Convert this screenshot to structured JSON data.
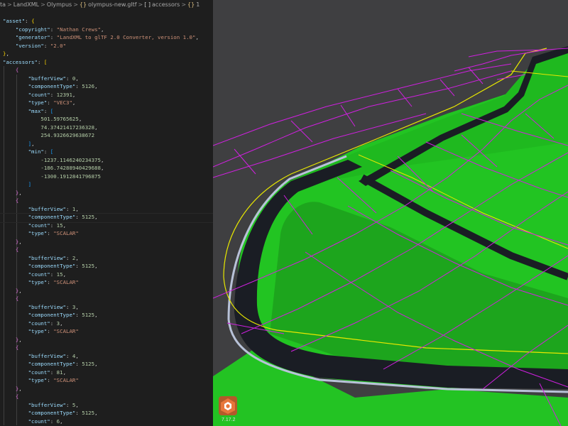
{
  "breadcrumb": {
    "items": [
      {
        "text": "ta",
        "icon": ""
      },
      {
        "text": "LandXML",
        "icon": ""
      },
      {
        "text": "Olympus",
        "icon": ""
      },
      {
        "text": "olympus-new.gltf",
        "icon": "{}"
      },
      {
        "text": "accessors",
        "icon": "[ ]"
      },
      {
        "text": "1",
        "icon": "{}"
      }
    ],
    "separator": ">"
  },
  "code": {
    "lines": [
      [
        [
          "k",
          "\"asset\""
        ],
        [
          "p",
          ": "
        ],
        [
          "b1",
          "{"
        ]
      ],
      [
        [
          "p",
          "    "
        ],
        [
          "k",
          "\"copyright\""
        ],
        [
          "p",
          ": "
        ],
        [
          "s",
          "\"Nathan Crews\""
        ],
        [
          "p",
          ","
        ]
      ],
      [
        [
          "p",
          "    "
        ],
        [
          "k",
          "\"generator\""
        ],
        [
          "p",
          ": "
        ],
        [
          "s",
          "\"LandXML to glTF 2.0 Converter, version 1.0\""
        ],
        [
          "p",
          ","
        ]
      ],
      [
        [
          "p",
          "    "
        ],
        [
          "k",
          "\"version\""
        ],
        [
          "p",
          ": "
        ],
        [
          "s",
          "\"2.0\""
        ]
      ],
      [
        [
          "b1",
          "}"
        ],
        [
          "p",
          ","
        ]
      ],
      [
        [
          "k",
          "\"accessors\""
        ],
        [
          "p",
          ": "
        ],
        [
          "b1",
          "["
        ]
      ],
      [
        [
          "p",
          "    "
        ],
        [
          "b2",
          "{"
        ]
      ],
      [
        [
          "p",
          "        "
        ],
        [
          "k",
          "\"bufferView\""
        ],
        [
          "p",
          ": "
        ],
        [
          "n",
          "0"
        ],
        [
          "p",
          ","
        ]
      ],
      [
        [
          "p",
          "        "
        ],
        [
          "k",
          "\"componentType\""
        ],
        [
          "p",
          ": "
        ],
        [
          "n",
          "5126"
        ],
        [
          "p",
          ","
        ]
      ],
      [
        [
          "p",
          "        "
        ],
        [
          "k",
          "\"count\""
        ],
        [
          "p",
          ": "
        ],
        [
          "n",
          "12391"
        ],
        [
          "p",
          ","
        ]
      ],
      [
        [
          "p",
          "        "
        ],
        [
          "k",
          "\"type\""
        ],
        [
          "p",
          ": "
        ],
        [
          "s",
          "\"VEC3\""
        ],
        [
          "p",
          ","
        ]
      ],
      [
        [
          "p",
          "        "
        ],
        [
          "k",
          "\"max\""
        ],
        [
          "p",
          ": "
        ],
        [
          "b3",
          "["
        ]
      ],
      [
        [
          "p",
          "            "
        ],
        [
          "n",
          "501.59765625"
        ],
        [
          "p",
          ","
        ]
      ],
      [
        [
          "p",
          "            "
        ],
        [
          "n",
          "74.37421417236328"
        ],
        [
          "p",
          ","
        ]
      ],
      [
        [
          "p",
          "            "
        ],
        [
          "n",
          "254.9326629638672"
        ]
      ],
      [
        [
          "p",
          "        "
        ],
        [
          "b3",
          "]"
        ],
        [
          "p",
          ","
        ]
      ],
      [
        [
          "p",
          "        "
        ],
        [
          "k",
          "\"min\""
        ],
        [
          "p",
          ": "
        ],
        [
          "b3",
          "["
        ]
      ],
      [
        [
          "p",
          "            "
        ],
        [
          "n",
          "-1237.1146240234375"
        ],
        [
          "p",
          ","
        ]
      ],
      [
        [
          "p",
          "            "
        ],
        [
          "n",
          "-186.74288940429688"
        ],
        [
          "p",
          ","
        ]
      ],
      [
        [
          "p",
          "            "
        ],
        [
          "n",
          "-1300.1912841796875"
        ]
      ],
      [
        [
          "p",
          "        "
        ],
        [
          "b3",
          "]"
        ]
      ],
      [
        [
          "p",
          "    "
        ],
        [
          "b2",
          "}"
        ],
        [
          "p",
          ","
        ]
      ],
      [
        [
          "p",
          "    "
        ],
        [
          "b2",
          "{"
        ]
      ],
      [
        [
          "p",
          "        "
        ],
        [
          "k",
          "\"bufferView\""
        ],
        [
          "p",
          ": "
        ],
        [
          "n",
          "1"
        ],
        [
          "p",
          ","
        ]
      ],
      [
        [
          "p",
          "        "
        ],
        [
          "k",
          "\"componentType\""
        ],
        [
          "p",
          ": "
        ],
        [
          "n",
          "5125"
        ],
        [
          "p",
          ","
        ]
      ],
      [
        [
          "p",
          "        "
        ],
        [
          "k",
          "\"count\""
        ],
        [
          "p",
          ": "
        ],
        [
          "n",
          "15"
        ],
        [
          "p",
          ","
        ]
      ],
      [
        [
          "p",
          "        "
        ],
        [
          "k",
          "\"type\""
        ],
        [
          "p",
          ": "
        ],
        [
          "s",
          "\"SCALAR\""
        ]
      ],
      [
        [
          "p",
          "    "
        ],
        [
          "b2",
          "}"
        ],
        [
          "p",
          ","
        ]
      ],
      [
        [
          "p",
          "    "
        ],
        [
          "b2",
          "{"
        ]
      ],
      [
        [
          "p",
          "        "
        ],
        [
          "k",
          "\"bufferView\""
        ],
        [
          "p",
          ": "
        ],
        [
          "n",
          "2"
        ],
        [
          "p",
          ","
        ]
      ],
      [
        [
          "p",
          "        "
        ],
        [
          "k",
          "\"componentType\""
        ],
        [
          "p",
          ": "
        ],
        [
          "n",
          "5125"
        ],
        [
          "p",
          ","
        ]
      ],
      [
        [
          "p",
          "        "
        ],
        [
          "k",
          "\"count\""
        ],
        [
          "p",
          ": "
        ],
        [
          "n",
          "15"
        ],
        [
          "p",
          ","
        ]
      ],
      [
        [
          "p",
          "        "
        ],
        [
          "k",
          "\"type\""
        ],
        [
          "p",
          ": "
        ],
        [
          "s",
          "\"SCALAR\""
        ]
      ],
      [
        [
          "p",
          "    "
        ],
        [
          "b2",
          "}"
        ],
        [
          "p",
          ","
        ]
      ],
      [
        [
          "p",
          "    "
        ],
        [
          "b2",
          "{"
        ]
      ],
      [
        [
          "p",
          "        "
        ],
        [
          "k",
          "\"bufferView\""
        ],
        [
          "p",
          ": "
        ],
        [
          "n",
          "3"
        ],
        [
          "p",
          ","
        ]
      ],
      [
        [
          "p",
          "        "
        ],
        [
          "k",
          "\"componentType\""
        ],
        [
          "p",
          ": "
        ],
        [
          "n",
          "5125"
        ],
        [
          "p",
          ","
        ]
      ],
      [
        [
          "p",
          "        "
        ],
        [
          "k",
          "\"count\""
        ],
        [
          "p",
          ": "
        ],
        [
          "n",
          "3"
        ],
        [
          "p",
          ","
        ]
      ],
      [
        [
          "p",
          "        "
        ],
        [
          "k",
          "\"type\""
        ],
        [
          "p",
          ": "
        ],
        [
          "s",
          "\"SCALAR\""
        ]
      ],
      [
        [
          "p",
          "    "
        ],
        [
          "b2",
          "}"
        ],
        [
          "p",
          ","
        ]
      ],
      [
        [
          "p",
          "    "
        ],
        [
          "b2",
          "{"
        ]
      ],
      [
        [
          "p",
          "        "
        ],
        [
          "k",
          "\"bufferView\""
        ],
        [
          "p",
          ": "
        ],
        [
          "n",
          "4"
        ],
        [
          "p",
          ","
        ]
      ],
      [
        [
          "p",
          "        "
        ],
        [
          "k",
          "\"componentType\""
        ],
        [
          "p",
          ": "
        ],
        [
          "n",
          "5125"
        ],
        [
          "p",
          ","
        ]
      ],
      [
        [
          "p",
          "        "
        ],
        [
          "k",
          "\"count\""
        ],
        [
          "p",
          ": "
        ],
        [
          "n",
          "81"
        ],
        [
          "p",
          ","
        ]
      ],
      [
        [
          "p",
          "        "
        ],
        [
          "k",
          "\"type\""
        ],
        [
          "p",
          ": "
        ],
        [
          "s",
          "\"SCALAR\""
        ]
      ],
      [
        [
          "p",
          "    "
        ],
        [
          "b2",
          "}"
        ],
        [
          "p",
          ","
        ]
      ],
      [
        [
          "p",
          "    "
        ],
        [
          "b2",
          "{"
        ]
      ],
      [
        [
          "p",
          "        "
        ],
        [
          "k",
          "\"bufferView\""
        ],
        [
          "p",
          ": "
        ],
        [
          "n",
          "5"
        ],
        [
          "p",
          ","
        ]
      ],
      [
        [
          "p",
          "        "
        ],
        [
          "k",
          "\"componentType\""
        ],
        [
          "p",
          ": "
        ],
        [
          "n",
          "5125"
        ],
        [
          "p",
          ","
        ]
      ],
      [
        [
          "p",
          "        "
        ],
        [
          "k",
          "\"count\""
        ],
        [
          "p",
          ": "
        ],
        [
          "n",
          "6"
        ],
        [
          "p",
          ","
        ]
      ]
    ],
    "current_line_index": 24
  },
  "viewport": {
    "version": "7.17.2",
    "logo_icon": "babylon-logo-icon",
    "colors": {
      "background": "#3f3f41",
      "surface": "#22c422",
      "surface_dark": "#169a16",
      "wireframe": "#d020e0",
      "alignment": "#e8e800",
      "curb": "#1a1d24",
      "curb_edge": "#b8c2d8"
    }
  },
  "colors": {
    "key": "#9cdcfe",
    "string": "#ce9178",
    "number": "#b5cea8",
    "punct": "#d4d4d4",
    "bracket_level1": "#ffd700",
    "bracket_level2": "#da70d6",
    "bracket_level3": "#179fff"
  }
}
